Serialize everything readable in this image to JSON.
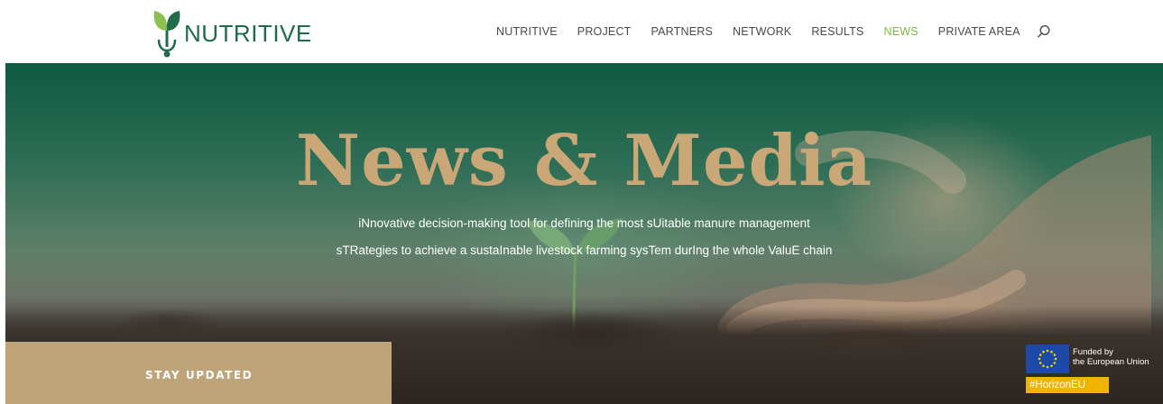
{
  "header": {
    "logo_text": "NUTRITIVE",
    "nav": [
      {
        "label": "NUTRITIVE"
      },
      {
        "label": "PROJECT"
      },
      {
        "label": "PARTNERS"
      },
      {
        "label": "NETWORK"
      },
      {
        "label": "RESULTS"
      },
      {
        "label": "NEWS",
        "active": true
      },
      {
        "label": "PRIVATE AREA"
      }
    ],
    "search_icon": "search-icon",
    "active_color": "#7dbb3f"
  },
  "hero": {
    "title": "News & Media",
    "subtitle_line1": "iNnovative decision-making tool for defining the most sUitable manure management",
    "subtitle_line2": "sTRategies to achieve a sustaInable livestock farming sysTem durIng the whole ValuE chain",
    "stay_updated": "STAY UPDATED",
    "title_color": "#c9a777",
    "box_color": "#bfa47a"
  },
  "eu": {
    "line1": "Funded by",
    "line2": "the European Union",
    "tag": "#HorizonEU"
  }
}
